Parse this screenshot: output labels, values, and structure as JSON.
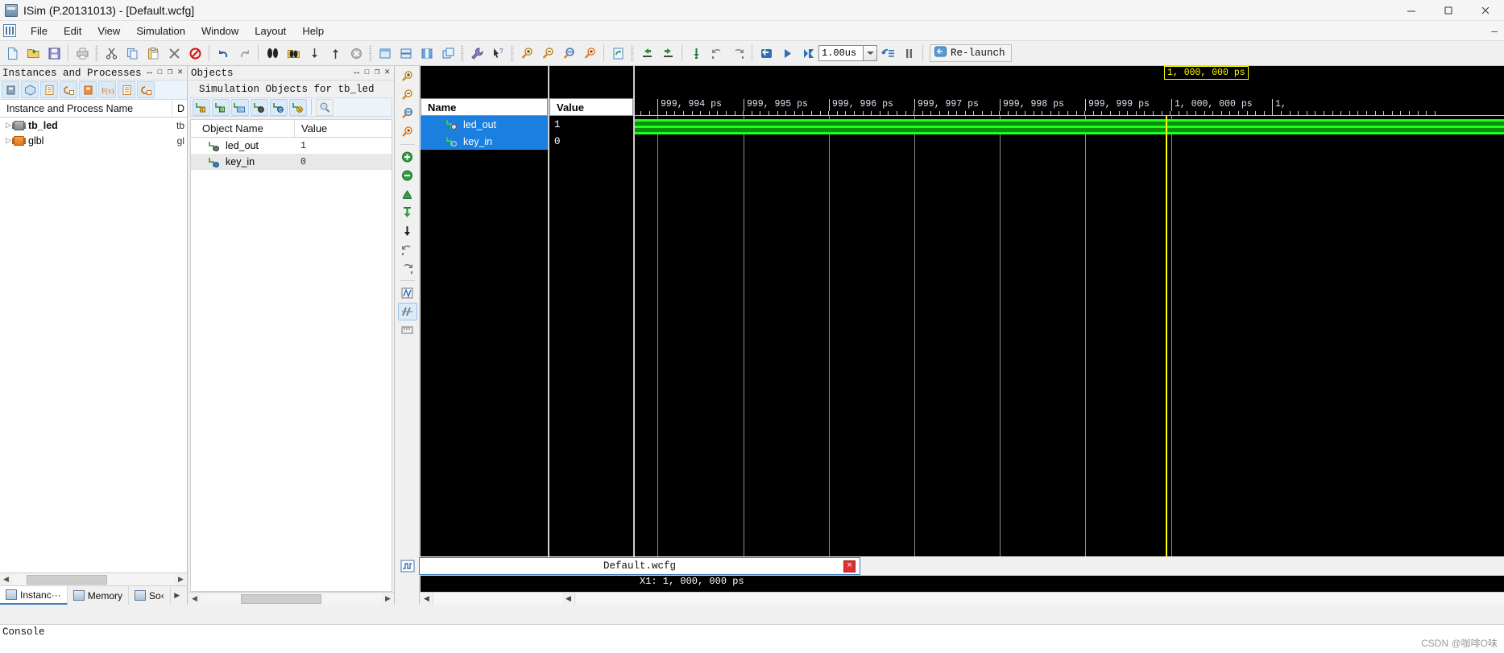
{
  "window": {
    "title": "ISim (P.20131013) - [Default.wcfg]",
    "icon": "isim-app-icon",
    "controls": {
      "minimize": "minimize-icon",
      "restore": "restore-icon",
      "close": "close-icon"
    }
  },
  "menu": {
    "icon": "wave-config-icon",
    "items": [
      "File",
      "Edit",
      "View",
      "Simulation",
      "Window",
      "Layout",
      "Help"
    ],
    "right_glyph": "–"
  },
  "toolbar": {
    "groups": [
      [
        "new-file-icon",
        "open-file-icon",
        "save-icon"
      ],
      [
        "print-icon"
      ],
      [
        "cut-icon",
        "copy-icon",
        "paste-icon",
        "delete-icon",
        "no-entry-icon"
      ],
      [
        "undo-icon",
        "redo-icon"
      ],
      [
        "find-icon",
        "find-in-files-icon",
        "down-arrow-icon",
        "up-arrow-icon",
        "cancel-icon"
      ],
      [
        "float-panel-icon",
        "tile-horizontal-icon",
        "tile-vertical-icon",
        "new-window-icon"
      ],
      [
        "settings-wrench-icon",
        "context-help-icon"
      ],
      [
        "zoom-in-icon",
        "zoom-out-icon",
        "zoom-fit-icon",
        "zoom-to-cursor-icon"
      ],
      [
        "refresh-icon"
      ],
      [
        "snap-to-previous-icon",
        "snap-to-next-icon"
      ],
      [
        "marker-down-icon",
        "prev-transition-icon",
        "next-transition-icon"
      ],
      [
        "restart-icon",
        "run-all-icon",
        "run-time-icon"
      ]
    ],
    "run_time_value": "1.00us",
    "run_time_dropdown": "chevron-down-icon",
    "step-icon": "step-icon",
    "pause_label": "||",
    "relaunch_label": "Re-launch",
    "relaunch_icon": "relaunch-icon"
  },
  "instances_panel": {
    "caption": "Instances and Processes",
    "caption_buttons": [
      "resize-icon",
      "maximize-icon",
      "restore-icon",
      "close-icon"
    ],
    "toolbar_icons": [
      "instance-chip-icon",
      "package-icon",
      "process-list-icon",
      "goto-source-icon",
      "design-unit-icon",
      "function-icon",
      "document-icon",
      "goto-instance-icon"
    ],
    "header": {
      "name": "Instance and Process Name",
      "design_unit": "D"
    },
    "rows": [
      {
        "name": "tb_led",
        "design_unit": "tb",
        "icon": "chip-gray-icon",
        "expander": "triangle-right"
      },
      {
        "name": "glbl",
        "design_unit": "gl",
        "icon": "chip-orange-icon",
        "expander": "triangle-right"
      }
    ],
    "tabs": [
      {
        "label": "Instanc···",
        "icon": "instances-tab-icon",
        "active": true
      },
      {
        "label": "Memory",
        "icon": "memory-tab-icon",
        "active": false
      },
      {
        "label": "So‹",
        "icon": "source-tab-icon",
        "active": false
      }
    ],
    "tab_nav": "▶"
  },
  "objects_panel": {
    "caption": "Objects",
    "caption_buttons": [
      "resize-icon",
      "maximize-icon",
      "restore-icon",
      "close-icon"
    ],
    "subtitle": "Simulation Objects for tb_led",
    "toolbar_icons": [
      "filter-input-icon",
      "filter-output-icon",
      "filter-inout-icon",
      "filter-internal-icon",
      "filter-constant-icon",
      "filter-variable-icon",
      "object-search-icon"
    ],
    "header": {
      "name": "Object Name",
      "value": "Value"
    },
    "rows": [
      {
        "name": "led_out",
        "value": "1",
        "icon": "signal-out-icon",
        "selected": false
      },
      {
        "name": "key_in",
        "value": "0",
        "icon": "signal-in-icon",
        "selected": true
      }
    ]
  },
  "wave_toolstrip": {
    "icons": [
      "zoom-in-icon",
      "zoom-out-icon",
      "zoom-fit-icon",
      "zoom-to-cursor-icon",
      "add-marker-icon",
      "delete-marker-icon",
      "marker-prev-icon",
      "marker-next-icon",
      "goto-start-icon",
      "goto-end-icon",
      "prev-transition-icon",
      "next-transition-icon",
      "measure-icon",
      "divider-icon",
      "ruler-icon"
    ]
  },
  "waveform": {
    "columns": {
      "name": "Name",
      "value": "Value"
    },
    "signals": [
      {
        "name": "led_out",
        "value": "1",
        "icon": "signal-out-icon",
        "selected": true,
        "color": "#1dff1d"
      },
      {
        "name": "key_in",
        "value": "0",
        "icon": "signal-in-icon",
        "selected": true,
        "color": "#1dff1d"
      }
    ],
    "ruler_labels": [
      "999, 994 ps",
      "999, 995 ps",
      "999, 996 ps",
      "999, 997 ps",
      "999, 998 ps",
      "999, 999 ps",
      "1, 000, 000 ps",
      "1,"
    ],
    "cursor": {
      "label": "1, 000, 000 ps",
      "color": "#ffff00"
    },
    "x1_label": "X1: 1, 000, 000 ps"
  },
  "document_tab": {
    "label": "Default.wcfg",
    "icon": "wave-config-icon",
    "close_label": "×"
  },
  "console": {
    "caption": "Console"
  },
  "watermark": "CSDN @咖啡O味"
}
